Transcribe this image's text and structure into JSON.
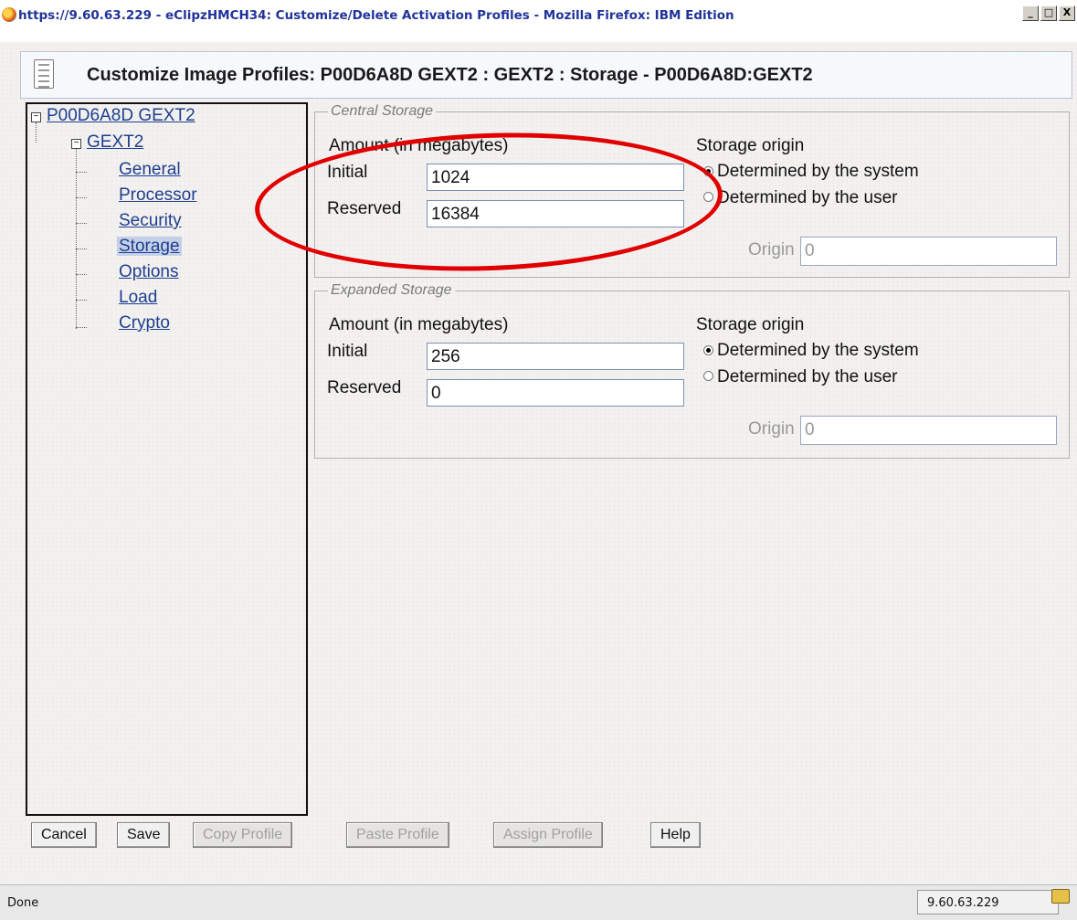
{
  "window": {
    "title": "https://9.60.63.229 - eClipzHMCH34: Customize/Delete Activation Profiles - Mozilla Firefox: IBM Edition",
    "buttons": [
      "_",
      "□",
      "X"
    ]
  },
  "header": {
    "title": "Customize Image Profiles: P00D6A8D GEXT2 : GEXT2 : Storage - P00D6A8D:GEXT2"
  },
  "tree": {
    "root": "P00D6A8D GEXT2",
    "child": "GEXT2",
    "items": [
      "General",
      "Processor",
      "Security",
      "Storage",
      "Options",
      "Load",
      "Crypto"
    ],
    "selected": "Storage",
    "expander_symbol": "−"
  },
  "central": {
    "legend": "Central Storage",
    "amount_label": "Amount (in megabytes)",
    "initial_label": "Initial",
    "initial_value": "1024",
    "reserved_label": "Reserved",
    "reserved_value": "16384",
    "origin_title": "Storage origin",
    "opt_system": "Determined by the system",
    "opt_user": "Determined by the user",
    "selected_origin": "system",
    "origin_label": "Origin",
    "origin_value": "0"
  },
  "expanded": {
    "legend": "Expanded Storage",
    "amount_label": "Amount (in megabytes)",
    "initial_label": "Initial",
    "initial_value": "256",
    "reserved_label": "Reserved",
    "reserved_value": "0",
    "origin_title": "Storage origin",
    "opt_system": "Determined by the system",
    "opt_user": "Determined by the user",
    "selected_origin": "system",
    "origin_label": "Origin",
    "origin_value": "0"
  },
  "buttons": {
    "cancel": "Cancel",
    "save": "Save",
    "copy": "Copy Profile",
    "paste": "Paste Profile",
    "assign": "Assign Profile",
    "help": "Help"
  },
  "status": {
    "text": "Done",
    "host": "9.60.63.229"
  },
  "colors": {
    "annotation": "#e00000",
    "link": "#1d3f8f"
  }
}
